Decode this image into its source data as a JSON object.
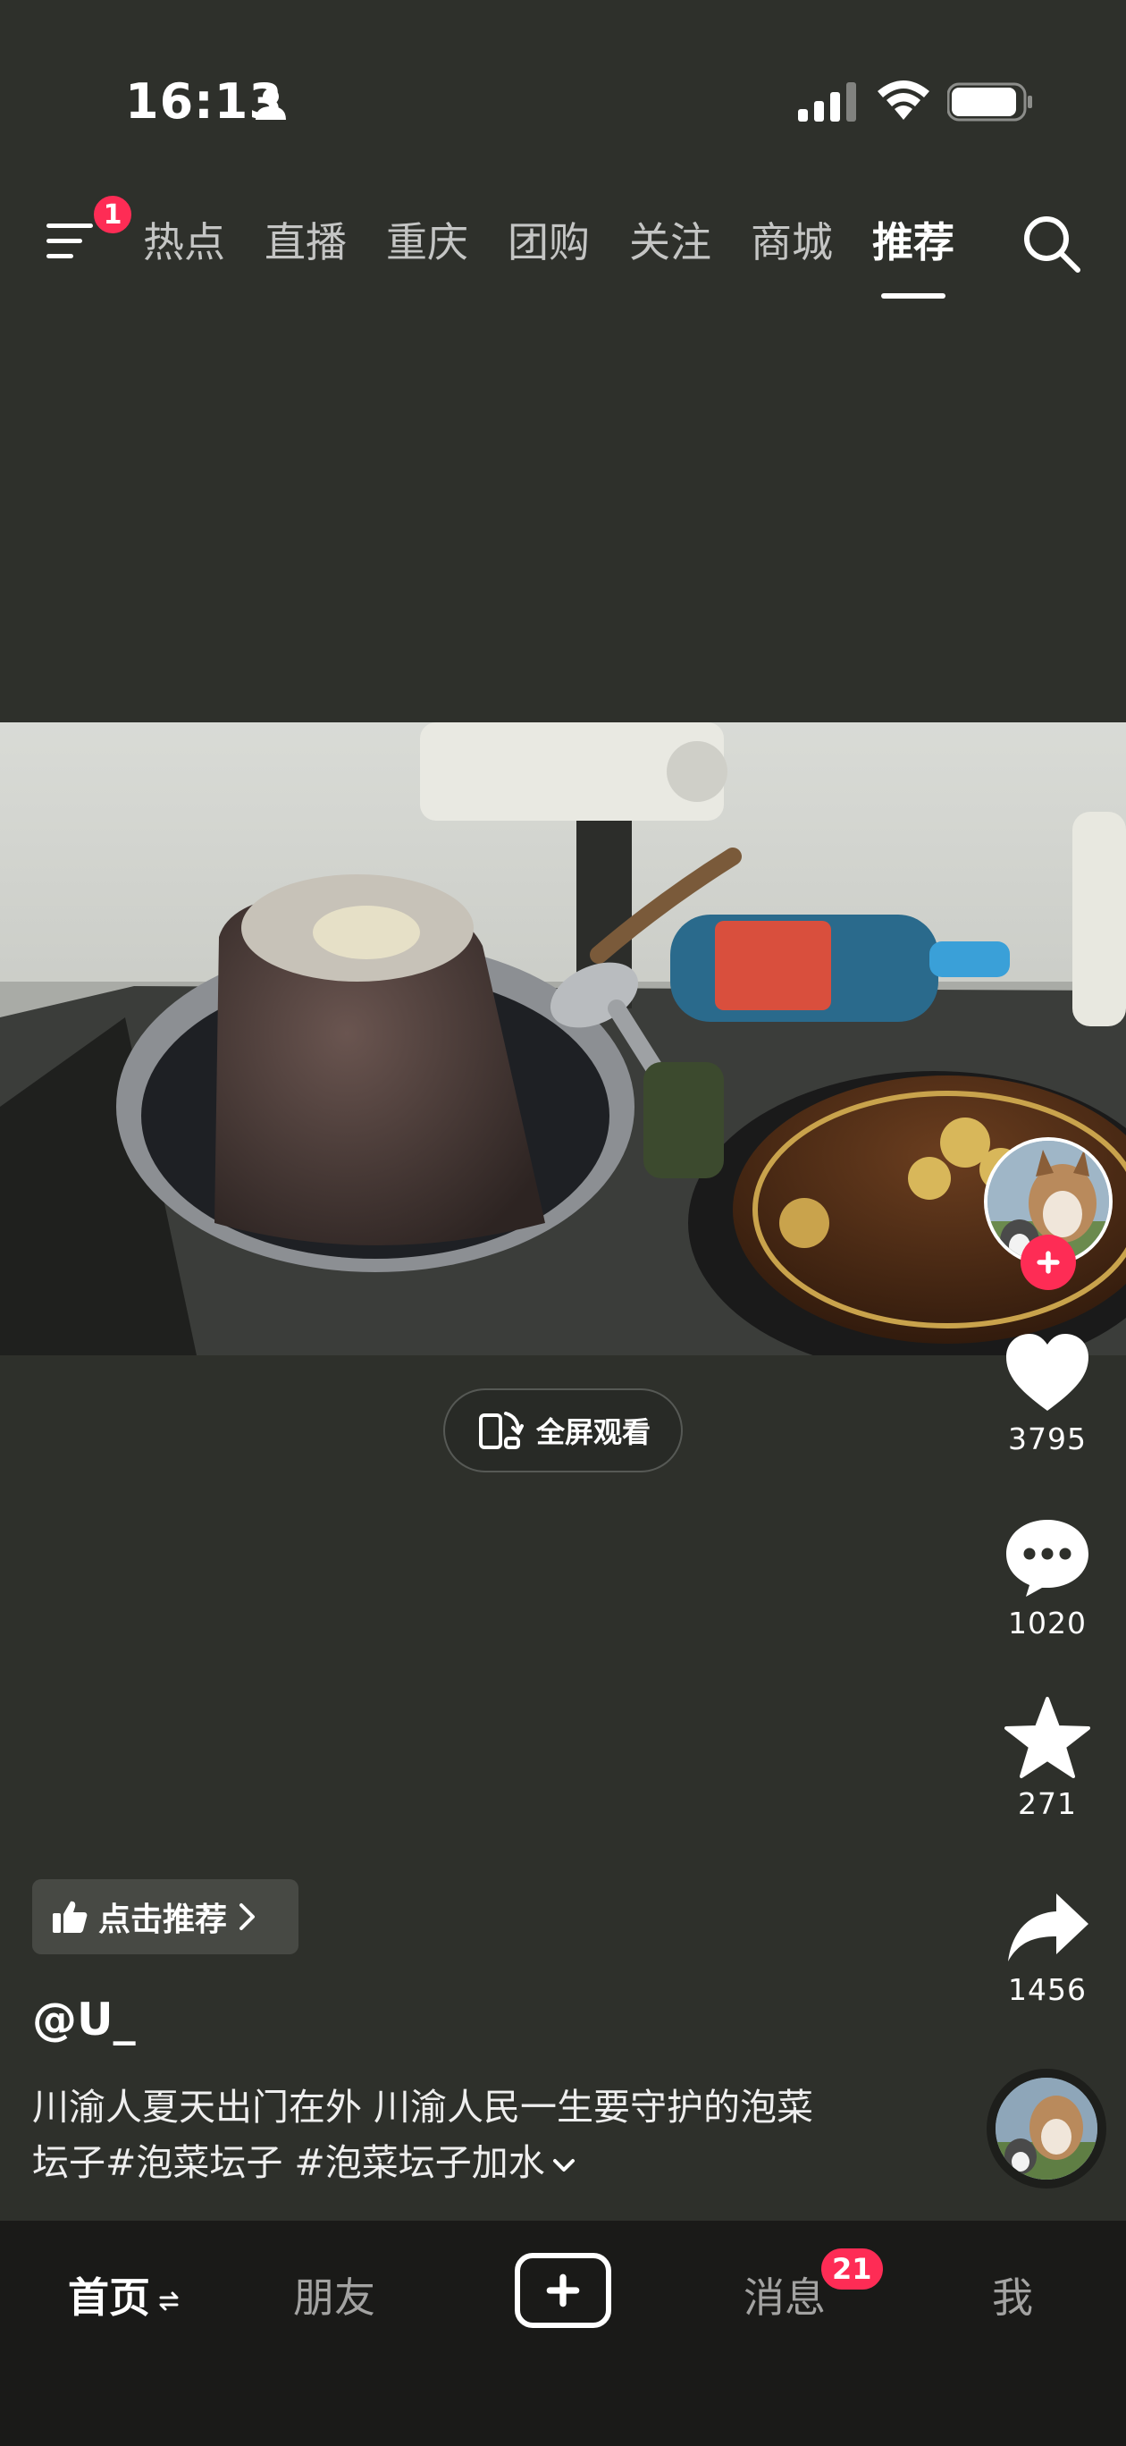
{
  "status_bar": {
    "time": "16:13"
  },
  "top_nav": {
    "menu_badge": "1",
    "tabs": [
      "热点",
      "直播",
      "重庆",
      "团购",
      "关注",
      "商城",
      "推荐"
    ],
    "active_tab": "推荐"
  },
  "video": {
    "fullscreen_label": "全屏观看"
  },
  "actions": {
    "likes": "3795",
    "comments": "1020",
    "favorites": "271",
    "shares": "1456"
  },
  "post": {
    "recommend_label": "点击推荐",
    "author": "@U_",
    "caption_line1": "川渝人夏天出门在外 川渝人民一生要守护的泡菜",
    "caption_line2": "坛子#泡菜坛子 #泡菜坛子加水"
  },
  "bottom_nav": {
    "home": "首页",
    "friends": "朋友",
    "messages": "消息",
    "messages_badge": "21",
    "me": "我"
  },
  "colors": {
    "background": "#2e302b",
    "accent": "#fe2c55",
    "nav_bar": "#1a1a18"
  }
}
